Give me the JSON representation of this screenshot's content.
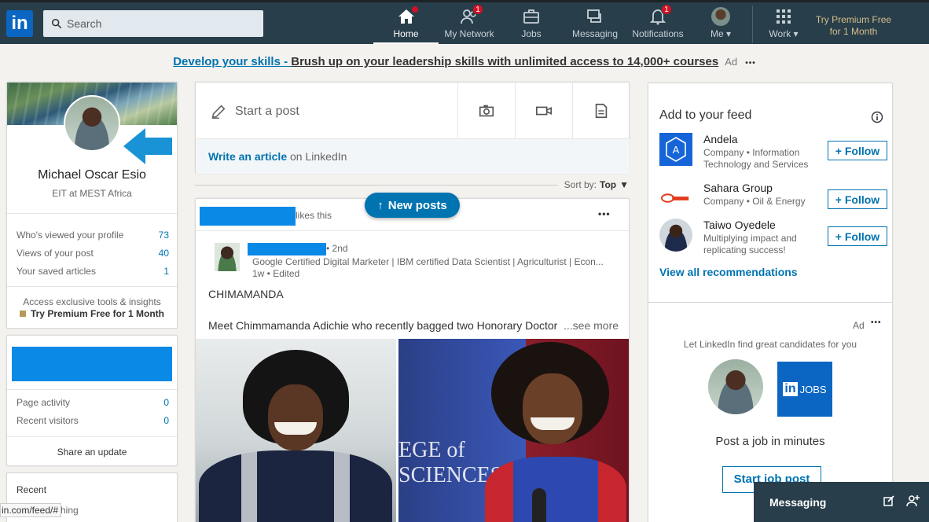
{
  "nav": {
    "search_placeholder": "Search",
    "items": [
      {
        "label": "Home",
        "badge": ""
      },
      {
        "label": "My Network",
        "badge": "1"
      },
      {
        "label": "Jobs",
        "badge": ""
      },
      {
        "label": "Messaging",
        "badge": ""
      },
      {
        "label": "Notifications",
        "badge": "1"
      },
      {
        "label": "Me",
        "badge": ""
      },
      {
        "label": "Work",
        "badge": ""
      }
    ],
    "premium": "Try Premium Free for 1 Month"
  },
  "ad_banner": {
    "link": "Develop your skills - ",
    "text": "Brush up on your leadership skills with unlimited access to 14,000+ courses",
    "ad": "Ad",
    "more": "•••"
  },
  "profile": {
    "name": "Michael Oscar Esio",
    "title": "EIT at MEST Africa",
    "stats": [
      {
        "label": "Who's viewed your profile",
        "value": "73"
      },
      {
        "label": "Views of your post",
        "value": "40"
      },
      {
        "label": "Your saved articles",
        "value": "1"
      }
    ],
    "access": "Access exclusive tools & insights",
    "try_premium": "Try Premium Free for 1 Month"
  },
  "page_card": {
    "stats": [
      {
        "label": "Page activity",
        "value": "0"
      },
      {
        "label": "Recent visitors",
        "value": "0"
      }
    ],
    "share": "Share an update"
  },
  "recent": {
    "title": "Recent",
    "item": "hing"
  },
  "share_box": {
    "start_post": "Start a post",
    "write_article": "Write an article",
    "on_linkedin": " on LinkedIn"
  },
  "sort": {
    "label": "Sort by:",
    "value": "Top"
  },
  "new_posts": "New posts",
  "post": {
    "likes_this": "likes this",
    "more": "•••",
    "degree": "• 2nd",
    "headline": "Google Certified Digital Marketer | IBM certified Data Scientist | Agriculturist | Econ...",
    "time": "1w • Edited",
    "text1": "CHIMAMANDA",
    "text2": "Meet Chimmamanda Adichie who recently bagged two Honorary Doctor",
    "see_more": "...see more",
    "photo_text": "EGE of SCIENCES"
  },
  "right": {
    "title": "Add to your feed",
    "recs": [
      {
        "name": "Andela",
        "desc": "Company • Information Technology and Services",
        "follow": "+ Follow"
      },
      {
        "name": "Sahara Group",
        "desc": "Company • Oil & Energy",
        "follow": "+ Follow"
      },
      {
        "name": "Taiwo Oyedele",
        "desc": "Multiplying impact and replicating success!",
        "follow": "+ Follow"
      }
    ],
    "view_all": "View all recommendations",
    "ad": "Ad",
    "ad_more": "•••",
    "ad_text": "Let LinkedIn find great candidates for you",
    "jobs_label": "JOBS",
    "post_job": "Post a job in minutes",
    "start_post_btn": "Start job post"
  },
  "messaging": "Messaging",
  "status_url": "in.com/feed/#",
  "colors": {
    "nav": "#283e4a",
    "brand": "#0073b1",
    "redact": "#0a8ae6",
    "premium": "#d6bf8c"
  }
}
